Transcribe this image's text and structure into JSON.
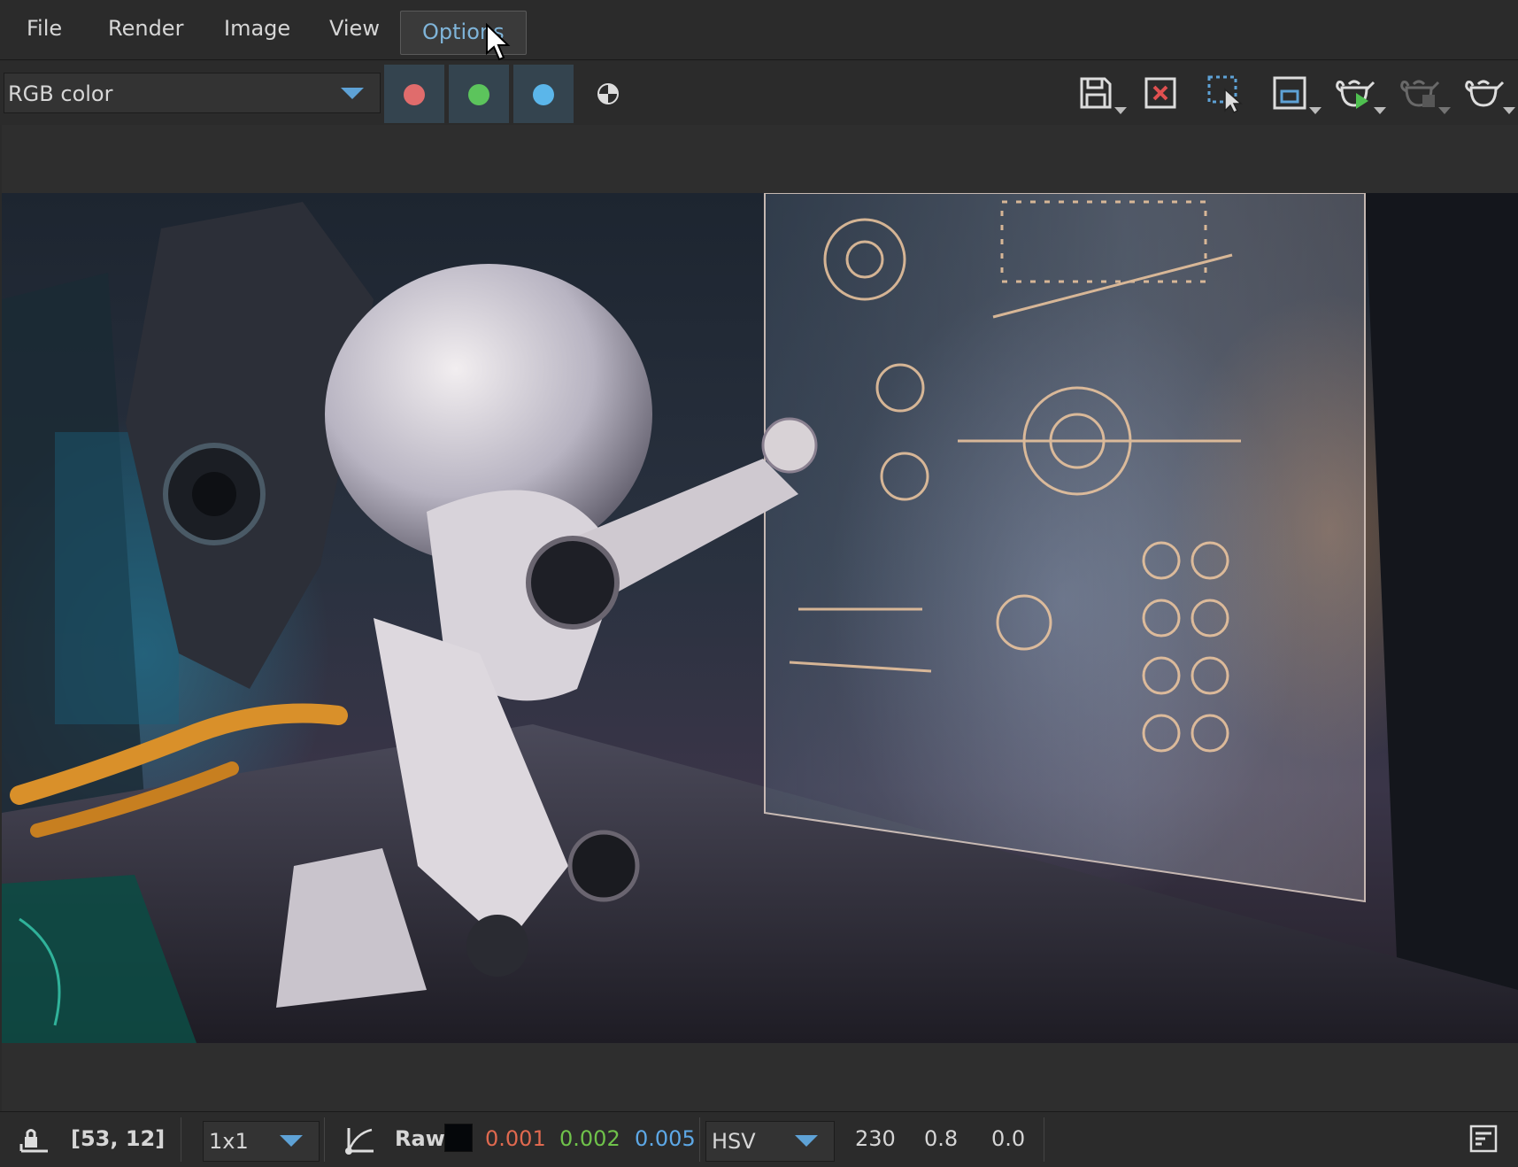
{
  "menubar": {
    "items": [
      {
        "label": "File"
      },
      {
        "label": "Render"
      },
      {
        "label": "Image"
      },
      {
        "label": "View"
      },
      {
        "label": "Options",
        "active": true
      }
    ]
  },
  "toolbar": {
    "channel_select": {
      "value": "RGB color"
    },
    "channels": [
      {
        "name": "red-channel",
        "color": "#e06c6c"
      },
      {
        "name": "green-channel",
        "color": "#5cc45c"
      },
      {
        "name": "blue-channel",
        "color": "#5bb6ea"
      }
    ],
    "accent_color": "#5ea2d6",
    "tools": [
      "save-icon",
      "clear-image-icon",
      "region-select-icon",
      "crop-region-icon",
      "start-render-icon",
      "stop-render-icon",
      "teapot-icon"
    ]
  },
  "image": {
    "description_icon": "render-output-image"
  },
  "statusbar": {
    "coords": "[53, 12]",
    "sample_size": "1x1",
    "mode_label": "Raw",
    "r": "0.001",
    "g": "0.002",
    "b": "0.005",
    "colorspace": "HSV",
    "h": "230",
    "s": "0.8",
    "v": "0.0",
    "r_color": "#e0694f",
    "g_color": "#6fc24a",
    "b_color": "#5da8e6"
  }
}
